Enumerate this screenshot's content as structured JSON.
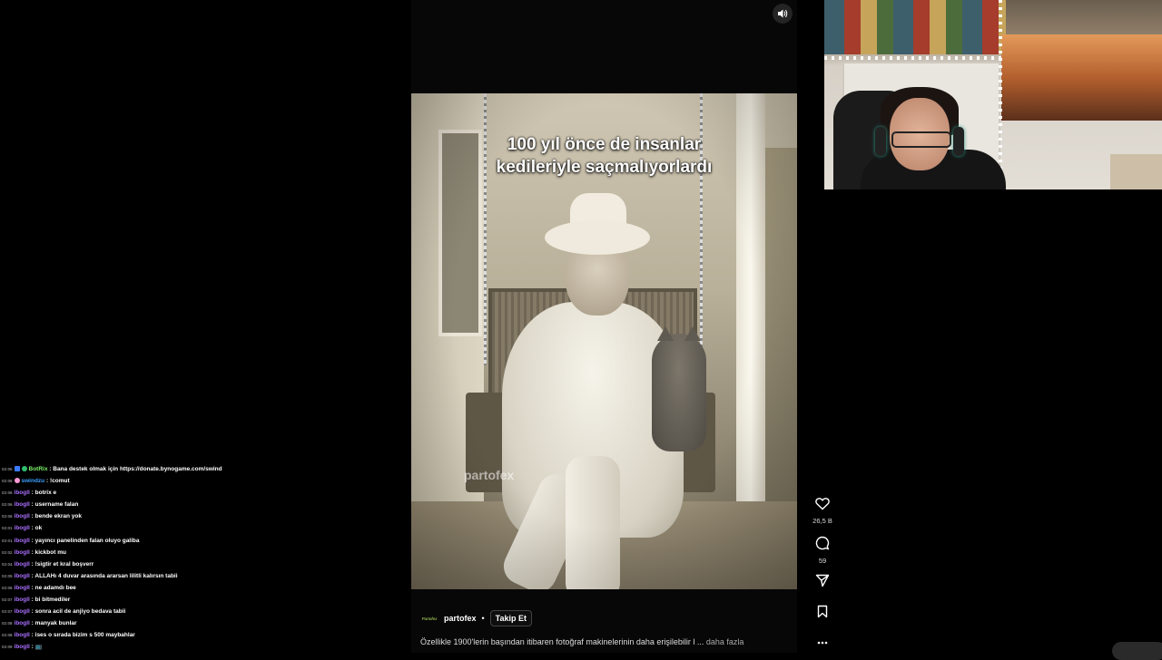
{
  "reel": {
    "caption_line1": "100 yıl önce de insanlar",
    "caption_line2": "kedileriyle saçmalıyorlardı",
    "watermark": "partofex",
    "account": {
      "avatar_text": "Partofex",
      "username": "partofex",
      "separator": "•",
      "follow_label": "Takip Et"
    },
    "description": "Özellikle 1900'lerin başından itibaren fotoğraf makinelerinin daha erişilebilir l ...",
    "more_label": "daha fazla"
  },
  "actions": {
    "likes": "26,5 B",
    "comments": "59"
  },
  "colors": {
    "chat_nick": "#a970ff",
    "botrix_nick": "#7cf26a",
    "swindzu_nick": "#3aa0ff"
  },
  "chat": [
    {
      "time": "02:05",
      "nick": "BotRix",
      "text": "Bana destek olmak için https://donate.bynogame.com/swind"
    },
    {
      "time": "02:06",
      "nick": "swindzu",
      "text": "!comut"
    },
    {
      "time": "02:06",
      "nick": "ibogll",
      "text": "botrix e"
    },
    {
      "time": "02:06",
      "nick": "ibogll",
      "text": "username falan"
    },
    {
      "time": "02:06",
      "nick": "ibogll",
      "text": "bende ekran yok"
    },
    {
      "time": "02:01",
      "nick": "ibogll",
      "text": "ok"
    },
    {
      "time": "02:01",
      "nick": "ibogll",
      "text": "yayıncı panelinden falan oluyo galiba"
    },
    {
      "time": "02:02",
      "nick": "ibogll",
      "text": "kickbot mu"
    },
    {
      "time": "02:04",
      "nick": "ibogll",
      "text": "!sigtir et kral boşverr"
    },
    {
      "time": "02:05",
      "nick": "ibogll",
      "text": "ALLAHı 4 duvar arasında ararsan lilitli kalırsın tabii"
    },
    {
      "time": "02:06",
      "nick": "ibogll",
      "text": "ne adamdı bee"
    },
    {
      "time": "02:07",
      "nick": "ibogll",
      "text": "bi bitmediler"
    },
    {
      "time": "02:07",
      "nick": "ibogll",
      "text": "sonra acil de anjiyo bedava tabii"
    },
    {
      "time": "02:08",
      "nick": "ibogll",
      "text": "manyak bunlar"
    },
    {
      "time": "02:08",
      "nick": "ibogll",
      "text": "ises o sırada bizim s 500 maybahlar"
    },
    {
      "time": "02:09",
      "nick": "ibogll",
      "text": "📺"
    }
  ]
}
